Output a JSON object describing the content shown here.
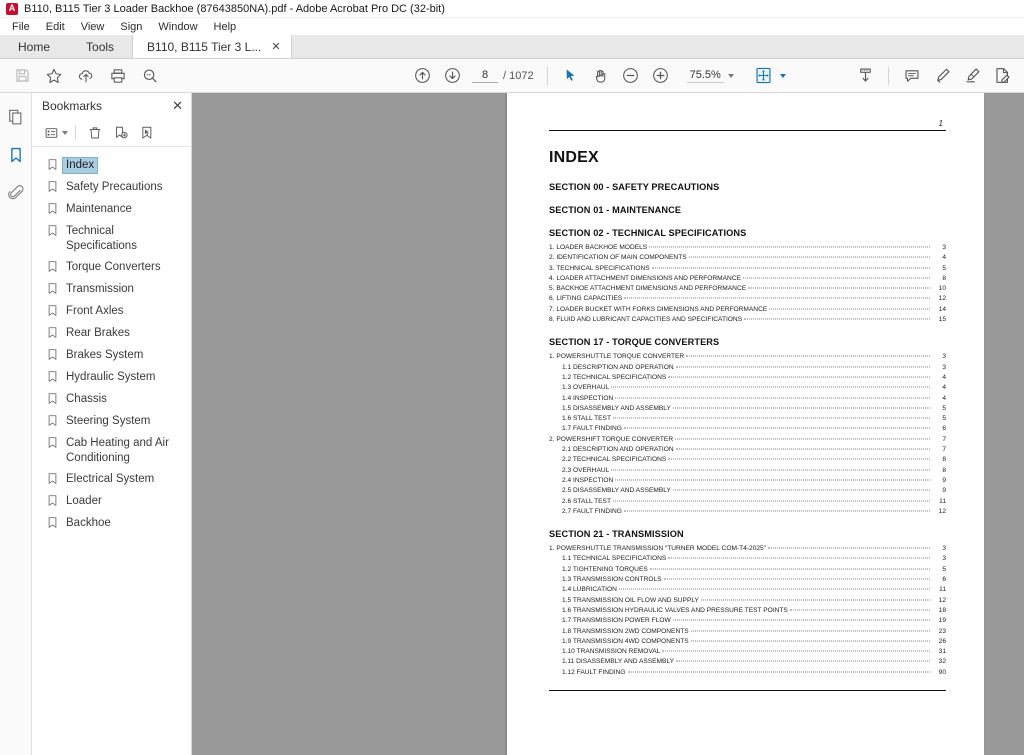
{
  "window": {
    "title": "B110, B115 Tier 3 Loader Backhoe (87643850NA).pdf - Adobe Acrobat Pro DC (32-bit)",
    "app_icon": "acrobat-logo"
  },
  "menu": [
    "File",
    "Edit",
    "View",
    "Sign",
    "Window",
    "Help"
  ],
  "tabs": {
    "home": "Home",
    "tools": "Tools",
    "document": "B110, B115 Tier 3 L...",
    "close": "✕"
  },
  "toolbar": {
    "left_icons": [
      "save-icon",
      "star-icon",
      "upload-cloud-icon",
      "print-icon",
      "search-icon"
    ],
    "prev_page": "previous-page-icon",
    "next_page": "next-page-icon",
    "page_current": "8",
    "page_separator": "/",
    "page_total": "1072",
    "select_tool": "cursor-select-icon",
    "hand_tool": "hand-pan-icon",
    "zoom_out": "zoom-out-icon",
    "zoom_in": "zoom-in-icon",
    "zoom_value": "75.5%",
    "fit_page": "fit-page-icon",
    "download_page": "download-page-icon",
    "comment": "comment-icon",
    "highlight": "highlight-pen-icon",
    "sign": "sign-pen-icon",
    "fill_sign": "fill-and-sign-icon"
  },
  "rail": {
    "pages": "page-thumbnails-icon",
    "bookmarks": "bookmarks-icon",
    "attachments": "attachments-paperclip-icon",
    "active": "bookmarks-icon"
  },
  "bookmarks_panel": {
    "title": "Bookmarks",
    "close": "✕",
    "tools": [
      "options-list-icon",
      "delete-bookmark-icon",
      "new-bookmark-icon",
      "select-bookmark-icon"
    ],
    "items": [
      {
        "label": "Index",
        "selected": true
      },
      {
        "label": "Safety Precautions",
        "selected": false
      },
      {
        "label": "Maintenance",
        "selected": false
      },
      {
        "label": "Technical Specifications",
        "selected": false
      },
      {
        "label": "Torque Converters",
        "selected": false
      },
      {
        "label": "Transmission",
        "selected": false
      },
      {
        "label": "Front Axles",
        "selected": false
      },
      {
        "label": "Rear Brakes",
        "selected": false
      },
      {
        "label": "Brakes System",
        "selected": false
      },
      {
        "label": "Hydraulic System",
        "selected": false
      },
      {
        "label": "Chassis",
        "selected": false
      },
      {
        "label": "Steering System",
        "selected": false
      },
      {
        "label": "Cab Heating and Air Conditioning",
        "selected": false
      },
      {
        "label": "Electrical System",
        "selected": false
      },
      {
        "label": "Loader",
        "selected": false
      },
      {
        "label": "Backhoe",
        "selected": false
      }
    ]
  },
  "document": {
    "page_label": "1",
    "title": "INDEX",
    "blocks": [
      {
        "heading": "SECTION 00 - SAFETY PRECAUTIONS",
        "entries": []
      },
      {
        "heading": "SECTION 01 - MAINTENANCE",
        "entries": []
      },
      {
        "heading": "SECTION 02 - TECHNICAL SPECIFICATIONS",
        "entries": [
          {
            "label": "1. LOADER BACKHOE MODELS",
            "page": "3",
            "level": 1
          },
          {
            "label": "2. IDENTIFICATION OF MAIN COMPONENTS",
            "page": "4",
            "level": 1
          },
          {
            "label": "3. TECHNICAL SPECIFICATIONS",
            "page": "5",
            "level": 1
          },
          {
            "label": "4. LOADER ATTACHMENT DIMENSIONS AND PERFORMANCE",
            "page": "8",
            "level": 1
          },
          {
            "label": "5. BACKHOE ATTACHMENT DIMENSIONS AND PERFORMANCE",
            "page": "10",
            "level": 1
          },
          {
            "label": "6. LIFTING CAPACITIES",
            "page": "12",
            "level": 1
          },
          {
            "label": "7. LOADER BUCKET WITH FORKS DIMENSIONS AND PERFORMANCE",
            "page": "14",
            "level": 1
          },
          {
            "label": "8. FLUID AND LUBRICANT CAPACITIES AND SPECIFICATIONS",
            "page": "15",
            "level": 1
          }
        ]
      },
      {
        "heading": "SECTION 17 - TORQUE CONVERTERS",
        "entries": [
          {
            "label": "1. POWERSHUTTLE TORQUE CONVERTER",
            "page": "3",
            "level": 1
          },
          {
            "label": "1.1 DESCRIPTION AND OPERATION",
            "page": "3",
            "level": 2
          },
          {
            "label": "1.2 TECHNICAL SPECIFICATIONS",
            "page": "4",
            "level": 2
          },
          {
            "label": "1.3 OVERHAUL",
            "page": "4",
            "level": 2
          },
          {
            "label": "1.4 INSPECTION",
            "page": "4",
            "level": 2
          },
          {
            "label": "1.5 DISASSEMBLY AND ASSEMBLY",
            "page": "5",
            "level": 2
          },
          {
            "label": "1.6 STALL TEST",
            "page": "5",
            "level": 2
          },
          {
            "label": "1.7 FAULT FINDING",
            "page": "6",
            "level": 2
          },
          {
            "label": "2. POWERSHIFT TORQUE CONVERTER",
            "page": "7",
            "level": 1
          },
          {
            "label": "2.1 DESCRIPTION AND OPERATION",
            "page": "7",
            "level": 2
          },
          {
            "label": "2.2 TECHNICAL SPECIFICATIONS",
            "page": "8",
            "level": 2
          },
          {
            "label": "2.3 OVERHAUL",
            "page": "8",
            "level": 2
          },
          {
            "label": "2.4 INSPECTION",
            "page": "9",
            "level": 2
          },
          {
            "label": "2.5 DISASSEMBLY AND ASSEMBLY",
            "page": "9",
            "level": 2
          },
          {
            "label": "2.6 STALL TEST",
            "page": "11",
            "level": 2
          },
          {
            "label": "2.7 FAULT FINDING",
            "page": "12",
            "level": 2
          }
        ]
      },
      {
        "heading": "SECTION 21 - TRANSMISSION",
        "entries": [
          {
            "label": "1. POWERSHUTTLE TRANSMISSION “TURNER MODEL COM-T4-2025”",
            "page": "3",
            "level": 1
          },
          {
            "label": "1.1 TECHNICAL SPECIFICATIONS",
            "page": "3",
            "level": 2
          },
          {
            "label": "1.2 TIGHTENING TORQUES",
            "page": "5",
            "level": 2
          },
          {
            "label": "1.3 TRANSMISSION CONTROLS",
            "page": "6",
            "level": 2
          },
          {
            "label": "1.4 LUBRICATION",
            "page": "11",
            "level": 2
          },
          {
            "label": "1.5 TRANSMISSION OIL FLOW AND SUPPLY",
            "page": "12",
            "level": 2
          },
          {
            "label": "1.6 TRANSMISSION HYDRAULIC VALVES AND PRESSURE TEST POINTS",
            "page": "18",
            "level": 2
          },
          {
            "label": "1.7 TRANSMISSION POWER FLOW",
            "page": "19",
            "level": 2
          },
          {
            "label": "1.8 TRANSMISSION 2WD COMPONENTS",
            "page": "23",
            "level": 2
          },
          {
            "label": "1.9 TRANSMISSION 4WD COMPONENTS",
            "page": "26",
            "level": 2
          },
          {
            "label": "1.10 TRANSMISSION REMOVAL",
            "page": "31",
            "level": 2
          },
          {
            "label": "1.11 DISASSEMBLY AND ASSEMBLY",
            "page": "32",
            "level": 2
          },
          {
            "label": "1.12 FAULT FINDING",
            "page": "90",
            "level": 2
          }
        ]
      }
    ]
  },
  "colors": {
    "accent": "#1473b5",
    "selection": "#a9cce0",
    "canvas": "#999999",
    "toolbar_bg": "#fafafa"
  }
}
